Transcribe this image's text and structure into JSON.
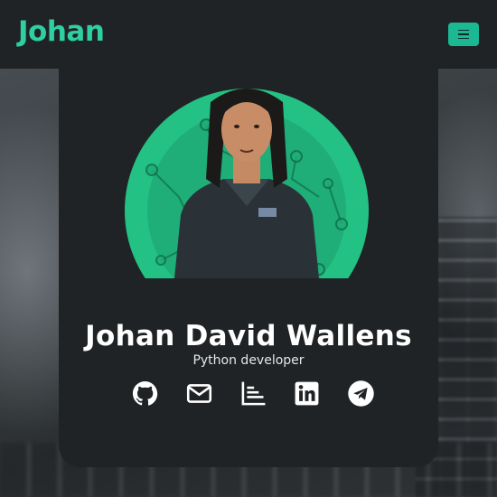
{
  "navbar": {
    "brand": "Johan",
    "menu_icon": "hamburger-menu-icon"
  },
  "profile": {
    "name": "Johan David Wallens",
    "role": "Python developer"
  },
  "socials": [
    {
      "icon": "github-icon"
    },
    {
      "icon": "envelope-icon"
    },
    {
      "icon": "bar-chart-icon"
    },
    {
      "icon": "linkedin-icon"
    },
    {
      "icon": "telegram-icon"
    }
  ],
  "colors": {
    "accent": "#2ecfa0",
    "toggler": "#1bb894",
    "card": "#202325",
    "text": "#ffffff"
  }
}
